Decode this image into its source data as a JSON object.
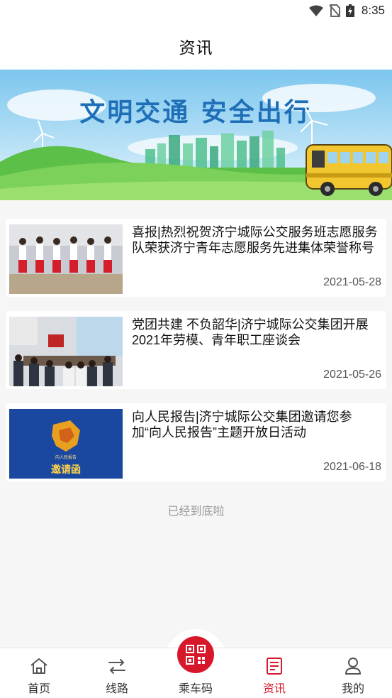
{
  "status": {
    "time": "8:35"
  },
  "header": {
    "title": "资讯"
  },
  "banner": {
    "slogan": "文明交通 安全出行"
  },
  "news": [
    {
      "title": "喜报|热烈祝贺济宁城际公交服务班志愿服务队荣获济宁青年志愿服务先进集体荣誉称号",
      "date": "2021-05-28"
    },
    {
      "title": "党团共建 不负韶华|济宁城际公交集团开展2021年劳模、青年职工座谈会",
      "date": "2021-05-26"
    },
    {
      "title": "向人民报告|济宁城际公交集团邀请您参加“向人民报告”主题开放日活动",
      "date": "2021-06-18",
      "thumb_text": "邀请函",
      "thumb_caption": "向人民报告"
    }
  ],
  "footer_text": "已经到底啦",
  "tabs": [
    {
      "label": "首页",
      "icon": "home-icon"
    },
    {
      "label": "线路",
      "icon": "route-arrows-icon"
    },
    {
      "label": "乘车码",
      "icon": "qr-code-icon"
    },
    {
      "label": "资讯",
      "icon": "news-icon"
    },
    {
      "label": "我的",
      "icon": "profile-icon"
    }
  ],
  "colors": {
    "accent": "#d7182a",
    "background": "#f6f6f6"
  }
}
